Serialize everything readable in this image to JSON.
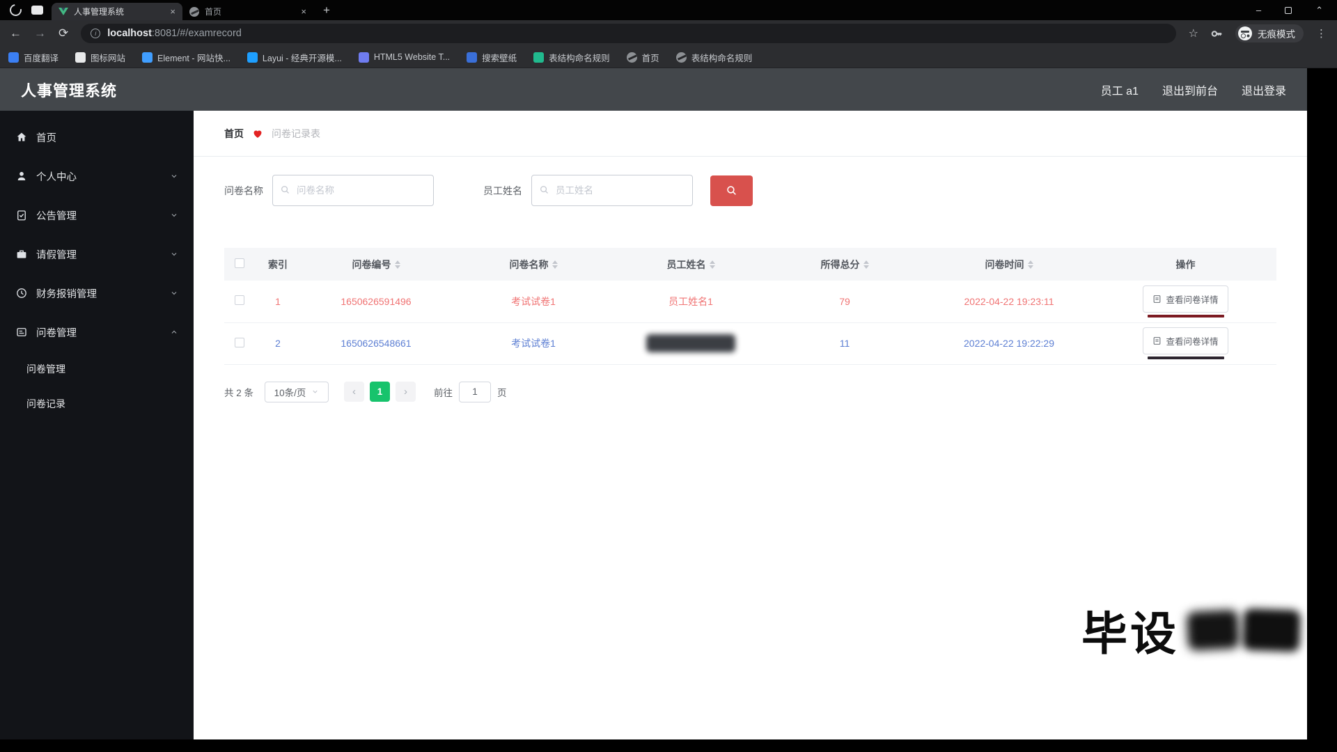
{
  "browser": {
    "tabs": [
      {
        "title": "人事管理系统"
      },
      {
        "title": "首页"
      }
    ],
    "url": {
      "host": "localhost",
      "rest": ":8081/#/examrecord"
    },
    "incognito_label": "无痕模式",
    "bookmarks": [
      {
        "label": "百度翻译",
        "color": "#3b7ff3"
      },
      {
        "label": "图标网站",
        "color": "#e8e9ea"
      },
      {
        "label": "Element - 网站快...",
        "color": "#409eff"
      },
      {
        "label": "Layui - 经典开源模...",
        "color": "#1e9fff"
      },
      {
        "label": "HTML5 Website T...",
        "color": "#6f7cf0"
      },
      {
        "label": "搜索壁纸",
        "color": "#3a6fd8"
      },
      {
        "label": "表结构命名规则",
        "color": "#21ba8e"
      },
      {
        "label": "首页",
        "color": "globe"
      },
      {
        "label": "表结构命名规则",
        "color": "globe"
      }
    ],
    "glyphs": {
      "minimize": "–",
      "chevron_up": "⌃",
      "close_tab": "×",
      "new_tab": "+",
      "back": "←",
      "forward": "→",
      "reload": "⟳",
      "star": "☆",
      "more": "⋮",
      "info": "i",
      "prev": "‹",
      "next": "›"
    }
  },
  "header": {
    "title": "人事管理系统",
    "user": "员工 a1",
    "logout_front": "退出到前台",
    "logout": "退出登录"
  },
  "sidebar": {
    "items": [
      {
        "label": "首页"
      },
      {
        "label": "个人中心"
      },
      {
        "label": "公告管理"
      },
      {
        "label": "请假管理"
      },
      {
        "label": "财务报销管理"
      },
      {
        "label": "问卷管理"
      }
    ],
    "submenu": [
      {
        "label": "问卷管理"
      },
      {
        "label": "问卷记录"
      }
    ]
  },
  "breadcrumb": {
    "home": "首页",
    "current": "问卷记录表"
  },
  "search": {
    "label1": "问卷名称",
    "placeholder1": "问卷名称",
    "label2": "员工姓名",
    "placeholder2": "员工姓名"
  },
  "table": {
    "headers": [
      "索引",
      "问卷编号",
      "问卷名称",
      "员工姓名",
      "所得总分",
      "问卷时间",
      "操作"
    ],
    "rows": [
      {
        "index": "1",
        "exam_no": "1650626591496",
        "exam_name": "考试试卷1",
        "employee": "员工姓名1",
        "score": "79",
        "time": "2022-04-22 19:23:11",
        "action": "查看问卷详情",
        "color": "#f07373",
        "employee_redacted": false
      },
      {
        "index": "2",
        "exam_no": "1650626548661",
        "exam_name": "考试试卷1",
        "employee": "",
        "score": "11",
        "time": "2022-04-22 19:22:29",
        "action": "查看问卷详情",
        "color": "#5d7fd3",
        "employee_redacted": true
      }
    ]
  },
  "pagination": {
    "total": "共 2 条",
    "per_page": "10条/页",
    "page": "1",
    "goto_prefix": "前往",
    "goto_value": "1",
    "goto_suffix": "页"
  },
  "watermark": {
    "text": "毕设"
  },
  "colors": {
    "accent_red": "#d8514d",
    "accent_green": "#17c36c",
    "row_red": "#f07373",
    "row_blue": "#5d7fd3"
  }
}
